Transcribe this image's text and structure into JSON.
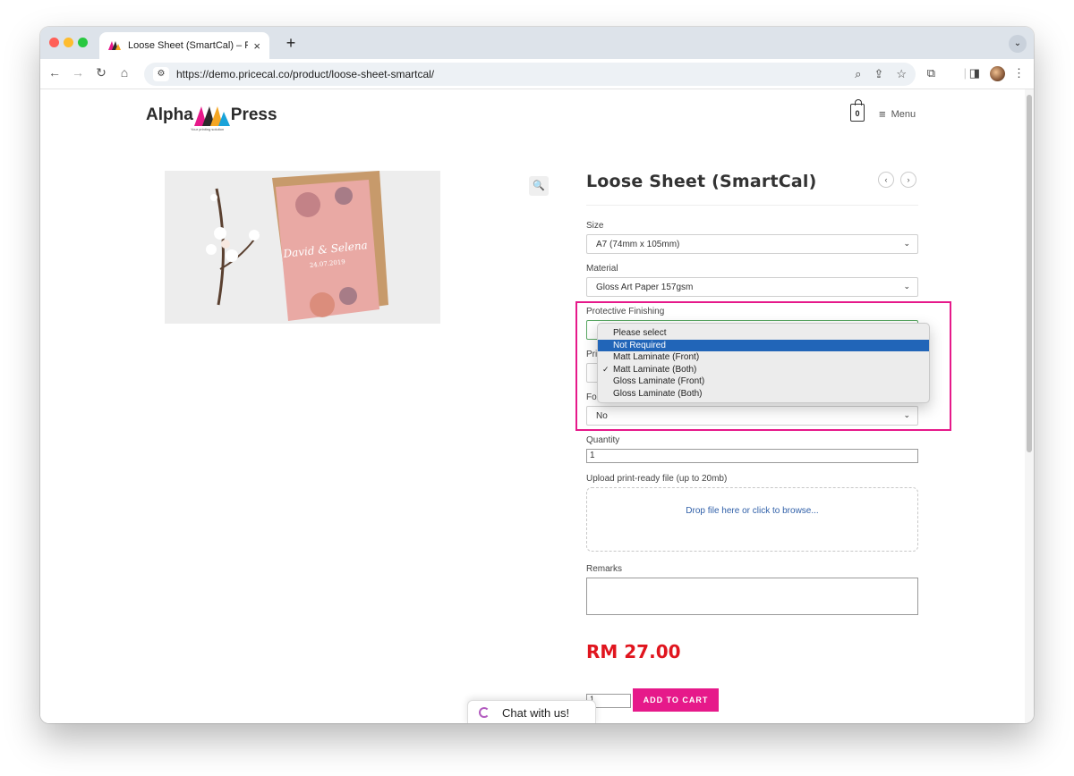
{
  "browser": {
    "tab_title": "Loose Sheet (SmartCal) – Pri",
    "tab_close": "×",
    "new_tab": "+",
    "url": "https://demo.pricecal.co/product/loose-sheet-smartcal/"
  },
  "header": {
    "logo_text_left": "Alpha",
    "logo_text_right": "Press",
    "logo_tagline": "Your printing solution",
    "cart_count": "0",
    "menu_label": "Menu"
  },
  "product": {
    "title": "Loose Sheet (SmartCal)",
    "image_card_text": "David & Selena",
    "image_card_date": "24.07.2019",
    "price": "RM 27.00",
    "add_to_cart": "ADD TO CART",
    "qty_value": "1"
  },
  "form": {
    "size": {
      "label": "Size",
      "value": "A7 (74mm x 105mm)"
    },
    "material": {
      "label": "Material",
      "value": "Gloss Art Paper 157gsm"
    },
    "protective": {
      "label": "Protective Finishing"
    },
    "printing_label_fragment": "Pri",
    "foil_label_fragment": "Fol",
    "foil_value": "No",
    "quantity": {
      "label": "Quantity",
      "value": "1"
    },
    "upload": {
      "label": "Upload print-ready file (up to 20mb)",
      "drop_text": "Drop file here or click to browse..."
    },
    "remarks": {
      "label": "Remarks"
    }
  },
  "dropdown": {
    "options": [
      {
        "label": "Please select",
        "selected": false,
        "checked": false
      },
      {
        "label": "Not Required",
        "selected": true,
        "checked": false
      },
      {
        "label": "Matt Laminate (Front)",
        "selected": false,
        "checked": false
      },
      {
        "label": "Matt Laminate (Both)",
        "selected": false,
        "checked": true
      },
      {
        "label": "Gloss Laminate (Front)",
        "selected": false,
        "checked": false
      },
      {
        "label": "Gloss Laminate (Both)",
        "selected": false,
        "checked": false
      }
    ]
  },
  "chat": {
    "label": "Chat with us!"
  },
  "colors": {
    "accent": "#e6198a",
    "price": "#e0151e",
    "highlight": "#e6198a",
    "dropdown_selected": "#2165b8"
  }
}
